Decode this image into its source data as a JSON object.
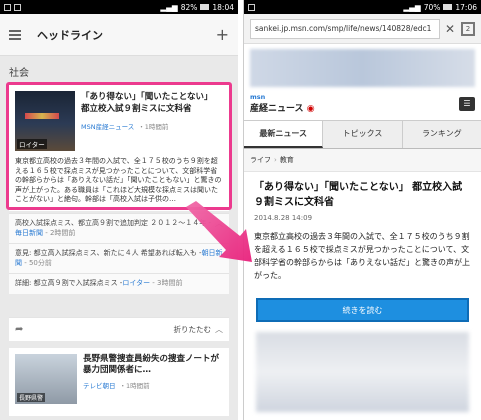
{
  "left": {
    "status": {
      "time": "18:04",
      "battery": "82%"
    },
    "appbar": {
      "title": "ヘッドライン"
    },
    "section": "社会",
    "story": {
      "title": "「あり得ない」「聞いたことない」 都立校入試９割ミスに文科省",
      "source": "MSN産経ニュース",
      "time": "・1時間前",
      "thumb_caption": "ロイター",
      "body": "東京都立高校の過去３年間の入試で、全１７５校のうち９割を超える１６５校で採点ミスが見つかったことについて、文部科学省の幹部らからは「ありえない話だ」「聞いたこともない」と驚きの声が上がった。ある職員は「これほど大規模な採点ミスは聞いたことがない」と絶句。幹部は「高校入試は子供の…"
    },
    "related": [
      {
        "text": "高校入試採点ミス、都立高９割で追加判定 ２０１２～１４年 -",
        "src": "毎日新聞",
        "time": " - 2時間前"
      },
      {
        "text": "意見: 都立高入試採点ミス、新たに４人 希望あれば転入も -",
        "src": "朝日新聞",
        "time": " - 50分前"
      },
      {
        "text": "詳細: 都立高９割で入試採点ミス -",
        "src": "ロイター",
        "time": " - 3時間前"
      }
    ],
    "fold_label": "折りたたむ",
    "story2": {
      "title": "長野県警捜査員紛失の捜査ノートが暴力団関係者に…",
      "source": "テレビ朝日",
      "time": "・1時間前",
      "thumb_caption": "長野県警"
    }
  },
  "right": {
    "status": {
      "time": "17:06",
      "battery": "70%"
    },
    "url": "sankei.jp.msn.com/smp/life/news/140828/edc1",
    "logo": {
      "brand": "msn",
      "name": "産経ニュース"
    },
    "tabs": [
      "最新ニュース",
      "トピックス",
      "ランキング"
    ],
    "breadcrumb": [
      "ライフ",
      "教育"
    ],
    "article": {
      "title": "「あり得ない」「聞いたことない」 都立校入試９割ミスに文科省",
      "date": "2014.8.28 14:09",
      "body": "東京都立高校の過去３年間の入試で、全１７５校のうち９割を超える１６５校で採点ミスが見つかったことについて、文部科学省の幹部らからは「ありえない話だ」と驚きの声が上がった。"
    },
    "read_more": "続きを読む"
  },
  "colors": {
    "highlight": "#ec3a8e",
    "link": "#2a7bd3",
    "button": "#1e8fe0"
  }
}
